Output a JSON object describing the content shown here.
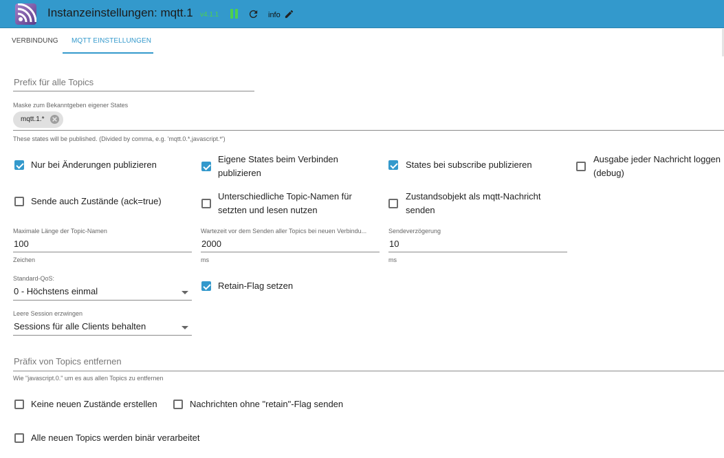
{
  "header": {
    "title": "Instanzeinstellungen: mqtt.1",
    "version": "v4.1.1",
    "info_label": "info",
    "accent_color": "#3399cc"
  },
  "tabs": [
    {
      "label": "VERBINDUNG"
    },
    {
      "label": "MQTT EINSTELLUNGEN"
    }
  ],
  "form": {
    "prefix_topics": {
      "placeholder": "Prefix für alle Topics"
    },
    "mask": {
      "label": "Maske zum Bekanntgeben eigener States",
      "chip": "mqtt.1.*",
      "helper": "These states will be published. (Divided by comma, e.g. 'mqtt.0.*,javascript.*')"
    },
    "checkboxes_row1": [
      {
        "label": "Nur bei Änderungen publizieren",
        "checked": true
      },
      {
        "label": "Eigene States beim Verbinden publizieren",
        "checked": true
      },
      {
        "label": "States bei subscribe publizieren",
        "checked": true
      },
      {
        "label": "Ausgabe jeder Nachricht loggen (debug)",
        "checked": false
      }
    ],
    "checkboxes_row2": [
      {
        "label": "Sende auch Zustände (ack=true)",
        "checked": false
      },
      {
        "label": "Unterschiedliche Topic-Namen für setzten und lesen nutzen",
        "checked": false
      },
      {
        "label": "Zustandsobjekt als mqtt-Nachricht senden",
        "checked": false
      }
    ],
    "max_topic_length": {
      "label": "Maximale Länge der Topic-Namen",
      "value": "100",
      "unit": "Zeichen"
    },
    "wait_time": {
      "label": "Wartezeit vor dem Senden aller Topics bei neuen Verbindu...",
      "value": "2000",
      "unit": "ms"
    },
    "send_delay": {
      "label": "Sendeverzögerung",
      "value": "10",
      "unit": "ms"
    },
    "qos": {
      "label": "Standard-QoS:",
      "value": "0 - Höchstens einmal"
    },
    "retain": {
      "label": "Retain-Flag setzen",
      "checked": true
    },
    "clean_session": {
      "label": "Leere Session erzwingen",
      "value": "Sessions für alle Clients behalten"
    },
    "remove_prefix": {
      "placeholder": "Präfix von Topics entfernen",
      "helper": "Wie \"javascript.0.\" um es aus allen Topics zu entfernen"
    },
    "no_new_states": {
      "label": "Keine neuen Zustände erstellen",
      "checked": false
    },
    "no_retain": {
      "label": "Nachrichten ohne \"retain\"-Flag senden",
      "checked": false
    },
    "binary": {
      "label": "Alle neuen Topics werden binär verarbeitet",
      "checked": false
    }
  }
}
